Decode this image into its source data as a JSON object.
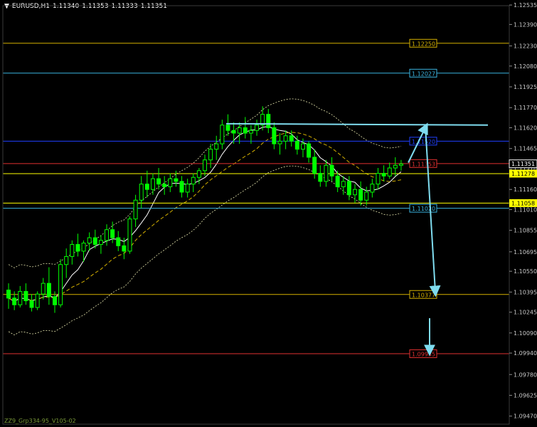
{
  "header": {
    "symbol": "EURUSD,H1",
    "open": "1.11340",
    "high": "1.11353",
    "low": "1.11333",
    "close": "1.11351"
  },
  "footer": {
    "label": "ZZ9_Grp334-95_V105-02"
  },
  "chart_data": {
    "type": "line",
    "title": "EURUSD,H1",
    "ylim": [
      1.0941,
      1.1253
    ],
    "y_ticks": [
      "1.12535",
      "1.12390",
      "1.12230",
      "1.12080",
      "1.11925",
      "1.11770",
      "1.11620",
      "1.11465",
      "1.11310",
      "1.11160",
      "1.11010",
      "1.10855",
      "1.10695",
      "1.10550",
      "1.10395",
      "1.10245",
      "1.10090",
      "1.09940",
      "1.09780",
      "1.09625",
      "1.09470"
    ],
    "current_price": {
      "value": 1.11351,
      "label": "1.11351",
      "color": "#ffffff"
    },
    "axis_markers": [
      {
        "value": 1.11278,
        "label": "1.11278",
        "color": "#ffff00"
      },
      {
        "value": 1.11058,
        "label": "1.11058",
        "color": "#ffff00"
      }
    ],
    "levels": [
      {
        "value": 1.1225,
        "label": "1.12250",
        "color": "#d4b000"
      },
      {
        "value": 1.12027,
        "label": "1.12027",
        "color": "#3ab4e0"
      },
      {
        "value": 1.1152,
        "label": "1.11520",
        "color": "#2040ff"
      },
      {
        "value": 1.11353,
        "label": "1.11353",
        "color": "#e03030"
      },
      {
        "value": 1.11278,
        "label": "",
        "color": "#ffff00"
      },
      {
        "value": 1.11058,
        "label": "",
        "color": "#ffff00"
      },
      {
        "value": 1.1102,
        "label": "1.11020",
        "color": "#3ab4e0"
      },
      {
        "value": 1.10377,
        "label": "1.10377",
        "color": "#d4b000"
      },
      {
        "value": 1.09935,
        "label": "1.09935",
        "color": "#e03030"
      }
    ],
    "bars": [
      {
        "o": 1.1041,
        "h": 1.1046,
        "l": 1.1027,
        "c": 1.1035
      },
      {
        "o": 1.1035,
        "h": 1.104,
        "l": 1.1026,
        "c": 1.103
      },
      {
        "o": 1.103,
        "h": 1.1044,
        "l": 1.1028,
        "c": 1.104
      },
      {
        "o": 1.104,
        "h": 1.1046,
        "l": 1.103,
        "c": 1.1033
      },
      {
        "o": 1.1033,
        "h": 1.1038,
        "l": 1.1025,
        "c": 1.1028
      },
      {
        "o": 1.1028,
        "h": 1.104,
        "l": 1.1026,
        "c": 1.1038
      },
      {
        "o": 1.1038,
        "h": 1.105,
        "l": 1.1034,
        "c": 1.1046
      },
      {
        "o": 1.1046,
        "h": 1.1058,
        "l": 1.103,
        "c": 1.1036
      },
      {
        "o": 1.1036,
        "h": 1.104,
        "l": 1.1024,
        "c": 1.103
      },
      {
        "o": 1.103,
        "h": 1.1064,
        "l": 1.1028,
        "c": 1.106
      },
      {
        "o": 1.106,
        "h": 1.1072,
        "l": 1.105,
        "c": 1.1066
      },
      {
        "o": 1.1066,
        "h": 1.1078,
        "l": 1.106,
        "c": 1.1075
      },
      {
        "o": 1.1075,
        "h": 1.1083,
        "l": 1.1066,
        "c": 1.107
      },
      {
        "o": 1.107,
        "h": 1.1078,
        "l": 1.1062,
        "c": 1.1076
      },
      {
        "o": 1.1076,
        "h": 1.1084,
        "l": 1.107,
        "c": 1.108
      },
      {
        "o": 1.108,
        "h": 1.1086,
        "l": 1.1072,
        "c": 1.1075
      },
      {
        "o": 1.1075,
        "h": 1.1082,
        "l": 1.1068,
        "c": 1.1078
      },
      {
        "o": 1.1078,
        "h": 1.109,
        "l": 1.1074,
        "c": 1.1086
      },
      {
        "o": 1.1086,
        "h": 1.1092,
        "l": 1.1076,
        "c": 1.108
      },
      {
        "o": 1.108,
        "h": 1.1085,
        "l": 1.107,
        "c": 1.1074
      },
      {
        "o": 1.1074,
        "h": 1.108,
        "l": 1.1064,
        "c": 1.107
      },
      {
        "o": 1.107,
        "h": 1.1096,
        "l": 1.1068,
        "c": 1.1094
      },
      {
        "o": 1.1094,
        "h": 1.1112,
        "l": 1.1088,
        "c": 1.1108
      },
      {
        "o": 1.1108,
        "h": 1.1126,
        "l": 1.1102,
        "c": 1.112
      },
      {
        "o": 1.112,
        "h": 1.113,
        "l": 1.111,
        "c": 1.1116
      },
      {
        "o": 1.1116,
        "h": 1.1128,
        "l": 1.1112,
        "c": 1.1124
      },
      {
        "o": 1.1124,
        "h": 1.1132,
        "l": 1.1116,
        "c": 1.112
      },
      {
        "o": 1.112,
        "h": 1.1126,
        "l": 1.1112,
        "c": 1.1118
      },
      {
        "o": 1.1118,
        "h": 1.1128,
        "l": 1.1114,
        "c": 1.1124
      },
      {
        "o": 1.1124,
        "h": 1.113,
        "l": 1.1118,
        "c": 1.1122
      },
      {
        "o": 1.1122,
        "h": 1.1126,
        "l": 1.111,
        "c": 1.1114
      },
      {
        "o": 1.1114,
        "h": 1.1124,
        "l": 1.111,
        "c": 1.112
      },
      {
        "o": 1.112,
        "h": 1.1128,
        "l": 1.1114,
        "c": 1.1125
      },
      {
        "o": 1.1125,
        "h": 1.1132,
        "l": 1.112,
        "c": 1.113
      },
      {
        "o": 1.113,
        "h": 1.1142,
        "l": 1.1126,
        "c": 1.1138
      },
      {
        "o": 1.1138,
        "h": 1.115,
        "l": 1.1132,
        "c": 1.1146
      },
      {
        "o": 1.1146,
        "h": 1.1156,
        "l": 1.1138,
        "c": 1.115
      },
      {
        "o": 1.115,
        "h": 1.1168,
        "l": 1.1146,
        "c": 1.1164
      },
      {
        "o": 1.1164,
        "h": 1.1172,
        "l": 1.1156,
        "c": 1.116
      },
      {
        "o": 1.116,
        "h": 1.1166,
        "l": 1.115,
        "c": 1.1158
      },
      {
        "o": 1.1158,
        "h": 1.1166,
        "l": 1.115,
        "c": 1.1162
      },
      {
        "o": 1.1162,
        "h": 1.117,
        "l": 1.1154,
        "c": 1.1158
      },
      {
        "o": 1.1158,
        "h": 1.1164,
        "l": 1.115,
        "c": 1.116
      },
      {
        "o": 1.116,
        "h": 1.1168,
        "l": 1.1156,
        "c": 1.1164
      },
      {
        "o": 1.1164,
        "h": 1.1178,
        "l": 1.116,
        "c": 1.1172
      },
      {
        "o": 1.1172,
        "h": 1.1176,
        "l": 1.1158,
        "c": 1.1162
      },
      {
        "o": 1.1162,
        "h": 1.1166,
        "l": 1.1146,
        "c": 1.115
      },
      {
        "o": 1.115,
        "h": 1.1158,
        "l": 1.1142,
        "c": 1.1152
      },
      {
        "o": 1.1152,
        "h": 1.116,
        "l": 1.1146,
        "c": 1.1156
      },
      {
        "o": 1.1156,
        "h": 1.116,
        "l": 1.1148,
        "c": 1.1152
      },
      {
        "o": 1.1152,
        "h": 1.1156,
        "l": 1.1142,
        "c": 1.1146
      },
      {
        "o": 1.1146,
        "h": 1.1154,
        "l": 1.114,
        "c": 1.115
      },
      {
        "o": 1.115,
        "h": 1.1152,
        "l": 1.1136,
        "c": 1.114
      },
      {
        "o": 1.114,
        "h": 1.1146,
        "l": 1.1124,
        "c": 1.1128
      },
      {
        "o": 1.1128,
        "h": 1.1134,
        "l": 1.1118,
        "c": 1.1122
      },
      {
        "o": 1.1122,
        "h": 1.1138,
        "l": 1.1118,
        "c": 1.1134
      },
      {
        "o": 1.1134,
        "h": 1.114,
        "l": 1.1122,
        "c": 1.1126
      },
      {
        "o": 1.1126,
        "h": 1.113,
        "l": 1.1114,
        "c": 1.1118
      },
      {
        "o": 1.1118,
        "h": 1.1126,
        "l": 1.1112,
        "c": 1.1122
      },
      {
        "o": 1.1122,
        "h": 1.1126,
        "l": 1.1108,
        "c": 1.1112
      },
      {
        "o": 1.1112,
        "h": 1.112,
        "l": 1.1106,
        "c": 1.1116
      },
      {
        "o": 1.1116,
        "h": 1.1122,
        "l": 1.1104,
        "c": 1.1108
      },
      {
        "o": 1.1108,
        "h": 1.1118,
        "l": 1.1104,
        "c": 1.1114
      },
      {
        "o": 1.1114,
        "h": 1.1124,
        "l": 1.111,
        "c": 1.112
      },
      {
        "o": 1.112,
        "h": 1.1132,
        "l": 1.1116,
        "c": 1.1128
      },
      {
        "o": 1.1128,
        "h": 1.1134,
        "l": 1.1122,
        "c": 1.1126
      },
      {
        "o": 1.1126,
        "h": 1.1136,
        "l": 1.1124,
        "c": 1.1132
      },
      {
        "o": 1.1132,
        "h": 1.114,
        "l": 1.1126,
        "c": 1.1134
      },
      {
        "o": 1.1134,
        "h": 1.1138,
        "l": 1.113,
        "c": 1.1135
      }
    ],
    "colors": {
      "candle": "#00ff00",
      "grid": "#1a1a1a",
      "axis_text": "#c8c8c8",
      "forecast_arrow": "#7fdcef"
    }
  }
}
